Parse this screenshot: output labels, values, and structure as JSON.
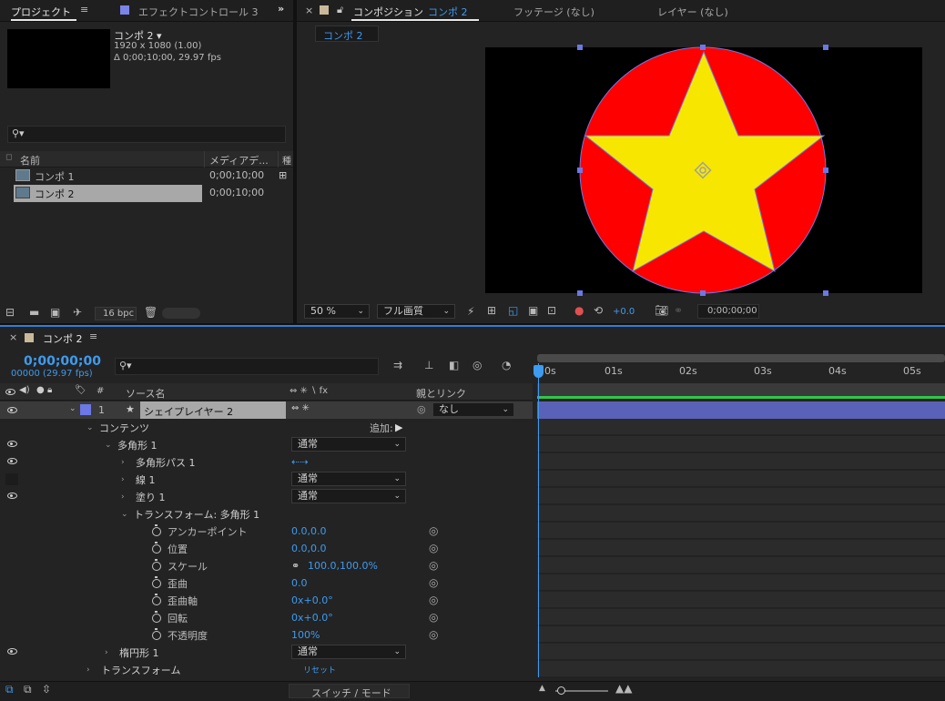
{
  "project_panel": {
    "tab_label": "プロジェクト",
    "effects_tab_label": "エフェクトコントロール 3",
    "selected_item_name": "コンポ 2 ▾",
    "selected_item_size": "1920 x 1080 (1.00)",
    "selected_item_duration": "Δ 0;00;10;00, 29.97 fps",
    "search_placeholder": "",
    "col_name": "名前",
    "col_media": "メディアデ...",
    "col_extra": "種",
    "items": [
      {
        "name": "コンポ 1",
        "duration": "0;00;10;00"
      },
      {
        "name": "コンポ 2",
        "duration": "0;00;10;00"
      }
    ],
    "bpc_label": "16 bpc"
  },
  "comp_panel": {
    "tab_label": "コンポジション",
    "tab_comp_name": "コンポ 2",
    "footage_tab": "フッテージ (なし)",
    "layer_tab": "レイヤー (なし)",
    "breadcrumb": "コンポ 2",
    "zoom": "50 %",
    "resolution": "フル画質",
    "exposure": "+0.0",
    "timecode": "0;00;00;00",
    "colors": {
      "circle": "#ff0000",
      "star": "#f7e600",
      "outline": "#6b78e6"
    }
  },
  "timeline": {
    "tab_label": "コンポ 2",
    "timecode": "0;00;00;00",
    "frames": "00000 (29.97 fps)",
    "col_hash": "#",
    "col_source": "ソース名",
    "col_switches": "⇔ ✳ ∖ fx",
    "col_parent": "親とリンク",
    "layer_index": "1",
    "layer_name": "シェイプレイヤー 2",
    "parent_value": "なし",
    "contents_label": "コンテンツ",
    "add_label": "追加:",
    "polygon_label": "多角形 1",
    "polygon_mode": "通常",
    "path_label": "多角形パス 1",
    "stroke_label": "線 1",
    "stroke_mode": "通常",
    "fill_label": "塗り 1",
    "fill_mode": "通常",
    "transform_group_label": "トランスフォーム: 多角形 1",
    "props": [
      {
        "name": "アンカーポイント",
        "value": "0.0,0.0"
      },
      {
        "name": "位置",
        "value": "0.0,0.0"
      },
      {
        "name": "スケール",
        "value": "100.0,100.0%"
      },
      {
        "name": "歪曲",
        "value": "0.0"
      },
      {
        "name": "歪曲軸",
        "value": "0x+0.0°"
      },
      {
        "name": "回転",
        "value": "0x+0.0°"
      },
      {
        "name": "不透明度",
        "value": "100%"
      }
    ],
    "ellipse_label": "楕円形 1",
    "ellipse_mode": "通常",
    "transform_label": "トランスフォーム",
    "reset_label": "リセット",
    "ruler": [
      "0s",
      "01s",
      "02s",
      "03s",
      "04s",
      "05s"
    ],
    "switch_mode_label": "スイッチ / モード"
  }
}
